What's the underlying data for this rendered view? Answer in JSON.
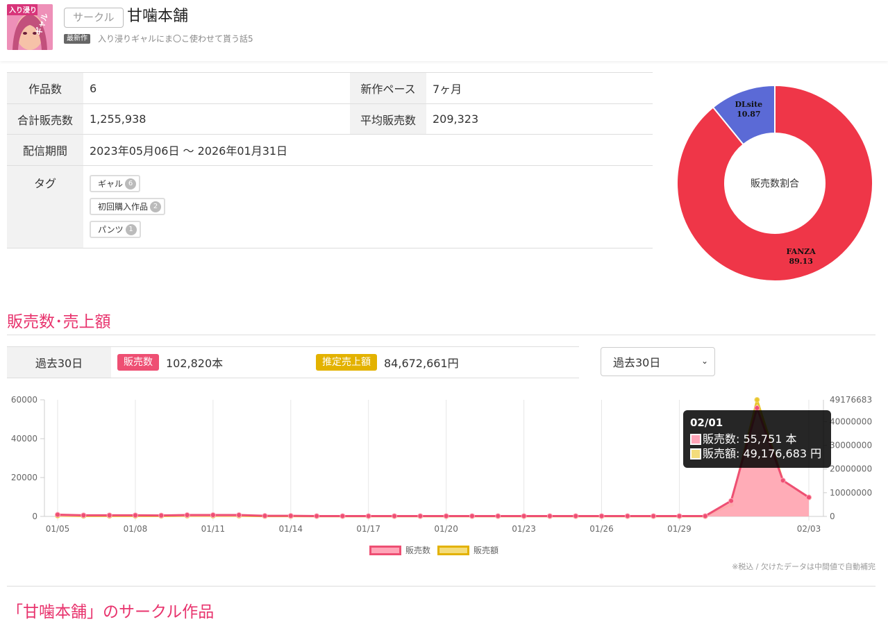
{
  "header": {
    "circle_tag": "サークル",
    "circle_name": "甘噛本舗",
    "new_badge": "最新作",
    "latest_title": "入り浸りギャルにま〇こ使わせて貰う話5",
    "thumb_text_top": "入り浸り",
    "thumb_text_bottom": "ギャル"
  },
  "info": {
    "works_label": "作品数",
    "works_value": "6",
    "pace_label": "新作ペース",
    "pace_value": "7ヶ月",
    "total_sales_label": "合計販売数",
    "total_sales_value": "1,255,938",
    "avg_sales_label": "平均販売数",
    "avg_sales_value": "209,323",
    "period_label": "配信期間",
    "period_value": "2023年05月06日 〜 2026年01月31日",
    "tags_label": "タグ",
    "tags": [
      {
        "name": "ギャル",
        "count": "6"
      },
      {
        "name": "初回購入作品",
        "count": "2"
      },
      {
        "name": "パンツ",
        "count": "1"
      }
    ]
  },
  "donut": {
    "center_label": "販売数割合",
    "slices": [
      {
        "name": "FANZA",
        "value": 89.13,
        "label": "89.13",
        "color": "#ef3648"
      },
      {
        "name": "DLsite",
        "value": 10.87,
        "label": "10.87",
        "color": "#5b6ad6"
      }
    ]
  },
  "sales_section": {
    "title": "販売数･売上額",
    "period": "過去30日",
    "sales_pill": "販売数",
    "sales_value": "102,820本",
    "revenue_pill": "推定売上額",
    "revenue_value": "84,672,661円",
    "select_value": "過去30日",
    "note": "※税込 / 欠けたデータは中間値で自動補完"
  },
  "chart_data": {
    "type": "line",
    "x": [
      "01/05",
      "01/06",
      "01/07",
      "01/08",
      "01/09",
      "01/10",
      "01/11",
      "01/12",
      "01/13",
      "01/14",
      "01/15",
      "01/16",
      "01/17",
      "01/18",
      "01/19",
      "01/20",
      "01/21",
      "01/22",
      "01/23",
      "01/24",
      "01/25",
      "01/26",
      "01/27",
      "01/28",
      "01/29",
      "01/30",
      "01/31",
      "02/01",
      "02/02",
      "02/03"
    ],
    "xticks": [
      "01/05",
      "01/08",
      "01/11",
      "01/14",
      "01/17",
      "01/20",
      "01/23",
      "01/26",
      "01/29",
      "02/03"
    ],
    "series": [
      {
        "name": "販売数",
        "axis": "left",
        "color": "#ee4f73",
        "fill": "#ffa5b8",
        "values": [
          900,
          600,
          600,
          600,
          500,
          700,
          700,
          700,
          300,
          300,
          200,
          200,
          200,
          200,
          200,
          200,
          200,
          200,
          200,
          200,
          200,
          200,
          200,
          200,
          200,
          200,
          8000,
          55751,
          18500,
          9800
        ]
      },
      {
        "name": "販売額",
        "axis": "right",
        "color": "#e8c62d",
        "fill": "#f3dc7c",
        "values": [
          300000,
          200000,
          200000,
          200000,
          200000,
          250000,
          250000,
          250000,
          100000,
          100000,
          80000,
          80000,
          80000,
          80000,
          80000,
          80000,
          80000,
          80000,
          80000,
          80000,
          80000,
          80000,
          80000,
          80000,
          80000,
          80000,
          5000000,
          49176683,
          15000000,
          8000000
        ]
      }
    ],
    "yleft": {
      "ticks": [
        0,
        20000,
        40000,
        60000
      ],
      "range": [
        0,
        60000
      ]
    },
    "yright": {
      "ticks": [
        0,
        10000000,
        20000000,
        30000000,
        40000000
      ],
      "max_label": "49176683",
      "range": [
        0,
        49176683
      ]
    },
    "tooltip": {
      "title": "02/01",
      "row1": "販売数: 55,751 本",
      "row2": "販売額: 49,176,683 円"
    }
  },
  "legend": {
    "sales": "販売数",
    "revenue": "販売額"
  },
  "works_section": {
    "title": "「甘噛本舗」のサークル作品"
  }
}
